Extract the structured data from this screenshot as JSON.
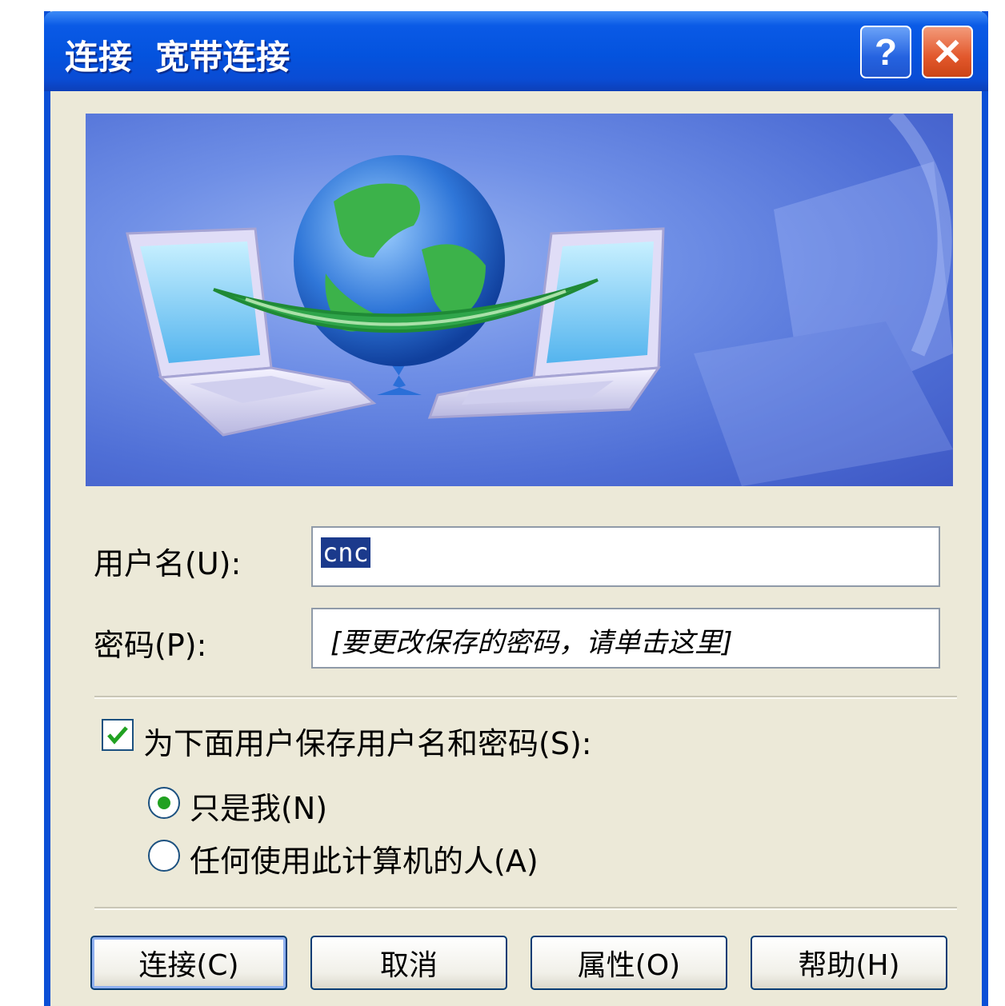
{
  "window": {
    "title": "连接  宽带连接",
    "help_glyph": "?",
    "close_glyph": "✕"
  },
  "form": {
    "username_label": "用户名(U):",
    "username_value": "cnc",
    "password_label": "密码(P):",
    "password_hint": "[要更改保存的密码，请单击这里]"
  },
  "save": {
    "checkbox_label": "为下面用户保存用户名和密码(S):",
    "checked": true,
    "options": [
      {
        "label": "只是我(N)",
        "selected": true
      },
      {
        "label": "任何使用此计算机的人(A)",
        "selected": false
      }
    ]
  },
  "buttons": {
    "connect": "连接(C)",
    "cancel": "取消",
    "properties": "属性(O)",
    "help": "帮助(H)"
  },
  "colors": {
    "titlebar": "#0453de",
    "dialog_bg": "#ece9d8",
    "selection": "#1b3a8c",
    "radio_dot": "#21a121"
  },
  "icons": {
    "banner": "network-globe-laptops-illustration",
    "help": "help-icon",
    "close": "close-icon"
  }
}
